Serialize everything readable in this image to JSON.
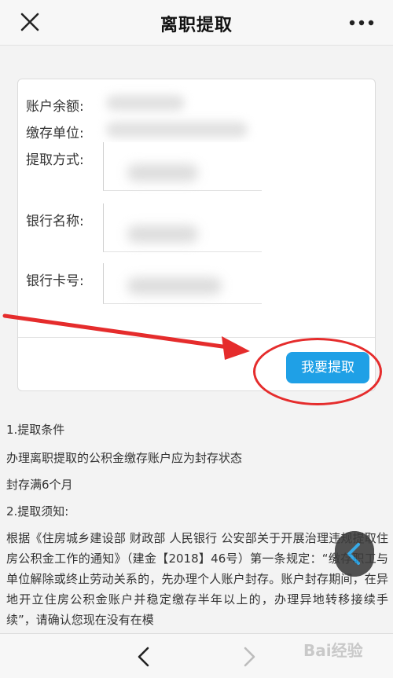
{
  "header": {
    "title": "离职提取",
    "close_icon": "close-icon",
    "more_icon": "more-dots-icon"
  },
  "form": {
    "balance_label": "账户余额:",
    "unit_label": "缴存单位:",
    "method_label": "提取方式:",
    "bank_name_label": "银行名称:",
    "card_number_label": "银行卡号:"
  },
  "submit_label": "我要提取",
  "info": {
    "section1_title": "1.提取条件",
    "section1_line1": "办理离职提取的公积金缴存账户应为封存状态",
    "section1_line2": "封存满6个月",
    "section2_title": "2.提取须知:",
    "section2_body": "根据《住房城乡建设部 财政部 人民银行 公安部关于开展治理违规提取住房公积金工作的通知》（建金【2018】46号）第一条规定：“缴存职工与单位解除或终止劳动关系的，先办理个人账户封存。账户封存期间，在异地开立住房公积金账户并稳定缴存半年以上的，办理异地转移接续手续”，请确认您现在没有在模"
  },
  "nav": {
    "back_icon": "chevron-left-icon",
    "forward_icon": "chevron-right-icon"
  },
  "watermark": "Bai经验",
  "colors": {
    "accent": "#1fa0e6",
    "annotation": "#e52c2c"
  }
}
